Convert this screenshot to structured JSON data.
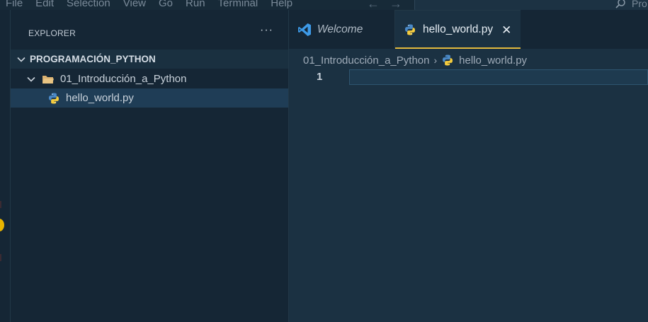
{
  "menu": {
    "items": [
      "File",
      "Edit",
      "Selection",
      "View",
      "Go",
      "Run",
      "Terminal",
      "Help"
    ]
  },
  "nav": {
    "back_icon": "arrow-left-icon",
    "forward_icon": "arrow-right-icon"
  },
  "command_center": {
    "text": "Pro",
    "icon": "search-icon"
  },
  "explorer": {
    "header": "EXPLORER",
    "more_label": "···",
    "root": {
      "label": "PROGRAMACIÓN_PYTHON",
      "icon": "chevron-down-icon"
    },
    "folder": {
      "label": "01_Introducción_a_Python",
      "icon": "folder-open-icon"
    },
    "file": {
      "label": "hello_world.py",
      "icon": "python-icon"
    }
  },
  "tabs": [
    {
      "label": "Welcome",
      "icon": "vscode-icon",
      "active": false
    },
    {
      "label": "hello_world.py",
      "icon": "python-icon",
      "active": true,
      "close": "✕"
    }
  ],
  "breadcrumb": {
    "folder": "01_Introducción_a_Python",
    "separator": "›",
    "file": "hello_world.py"
  },
  "editor": {
    "line_numbers": [
      "1"
    ]
  },
  "colors": {
    "accent": "#e2b93d",
    "editor_bg": "#1b3142",
    "sidebar_bg": "#152635",
    "selection": "#1f3d56"
  }
}
